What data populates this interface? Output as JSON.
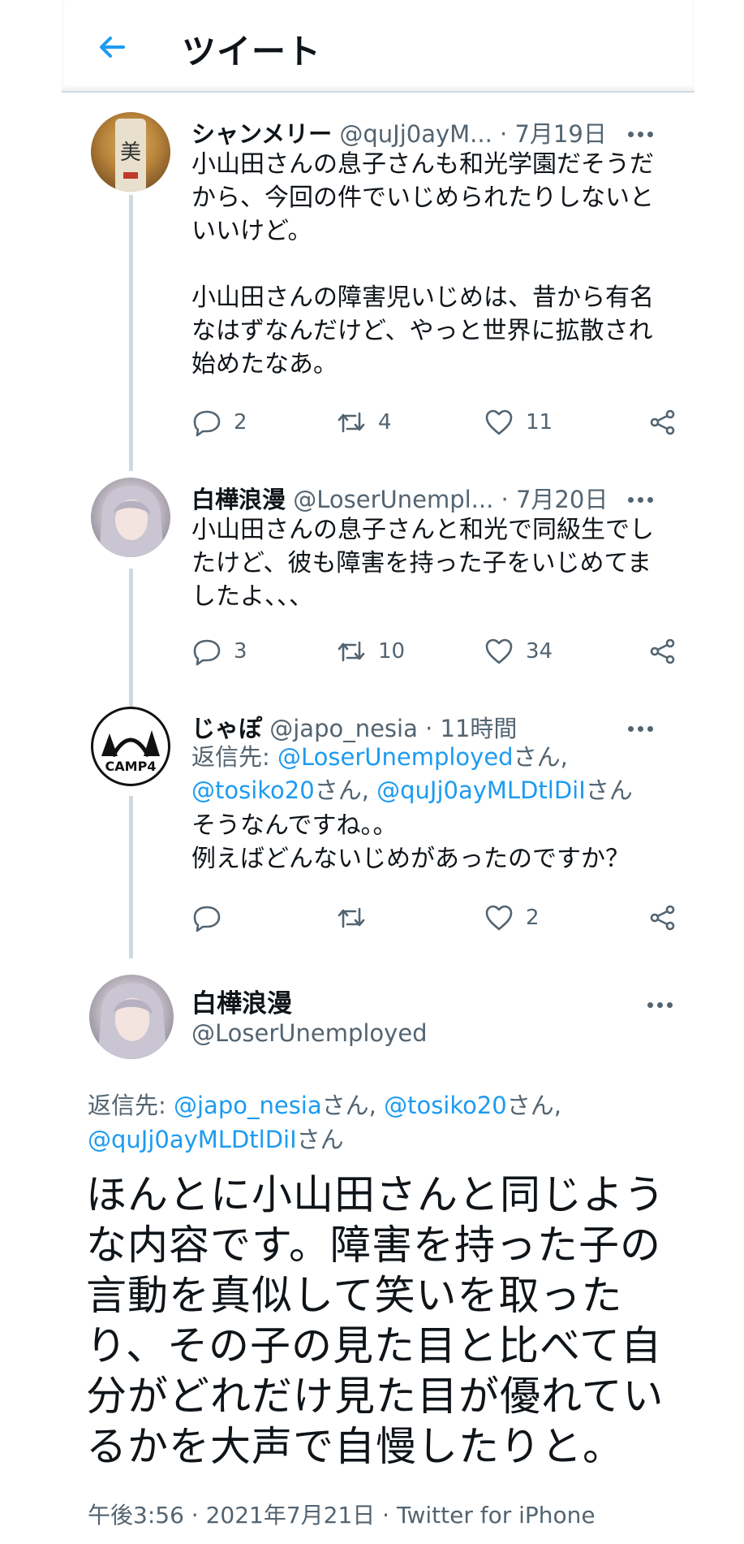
{
  "header": {
    "title": "ツイート"
  },
  "tweets": [
    {
      "name": "シャンメリー",
      "handle": "@quJj0ayM...",
      "time": "· 7月19日",
      "text": "小山田さんの息子さんも和光学園だそうだから、今回の件でいじめられたりしないといいけど。\n\n小山田さんの障害児いじめは、昔から有名なはずなんだけど、やっと世界に拡散され始めたなあ。",
      "replies": "2",
      "retweets": "4",
      "likes": "11"
    },
    {
      "name": "白樺浪漫",
      "handle": "@LoserUnempl...",
      "time": "· 7月20日",
      "text": "小山田さんの息子さんと和光で同級生でしたけど、彼も障害を持った子をいじめてましたよ、、、",
      "replies": "3",
      "retweets": "10",
      "likes": "34"
    },
    {
      "name": "じゃぽ",
      "handle": "@japo_nesia",
      "time": "· 11時間",
      "reply_label": "返信先: ",
      "reply_user1": "@LoserUnemployed",
      "reply_san1": "さん,",
      "reply_user2": "@tosiko20",
      "reply_san2": "さん, ",
      "reply_user3": "@quJj0ayMLDtlDiI",
      "reply_san3": "さん",
      "text": "そうなんですね。。\n例えばどんないじめがあったのですか？",
      "replies": "",
      "retweets": "",
      "likes": "2"
    }
  ],
  "focus": {
    "name": "白樺浪漫",
    "handle": "@LoserUnemployed",
    "reply_label": "返信先: ",
    "reply_user1": "@japo_nesia",
    "reply_san1": "さん, ",
    "reply_user2": "@tosiko20",
    "reply_san2": "さん,",
    "reply_user3": "@quJj0ayMLDtlDiI",
    "reply_san3": "さん",
    "text": "ほんとに小山田さんと同じような内容です。障害を持った子の言動を真似して笑いを取ったり、その子の見た目と比べて自分がどれだけ見た目が優れているかを大声で自慢したりと。",
    "meta": "午後3:56 · 2021年7月21日 · Twitter for iPhone"
  },
  "colors": {
    "link": "#1d9bf0",
    "secondary": "#536471",
    "thread": "#cfd9de"
  },
  "icons": [
    "back-arrow-icon",
    "more-icon",
    "reply-icon",
    "retweet-icon",
    "like-icon",
    "share-icon"
  ]
}
